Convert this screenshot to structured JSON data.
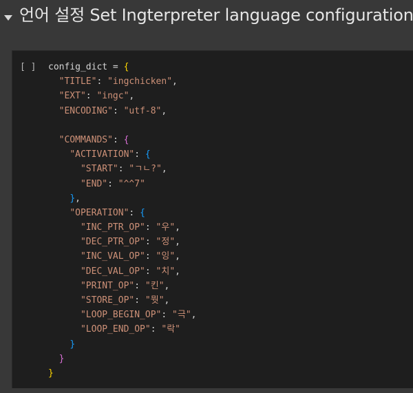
{
  "section": {
    "title": "언어 설정 Set Ingterpreter language configuration",
    "collapse_icon": "caret-down-icon"
  },
  "cell": {
    "run_indicator": "[ ]",
    "code_lines": [
      [
        {
          "t": "config_dict = ",
          "k": "plain"
        },
        {
          "t": "{",
          "k": "brace-0"
        }
      ],
      [
        {
          "t": "  ",
          "k": "plain"
        },
        {
          "t": "\"TITLE\"",
          "k": "string"
        },
        {
          "t": ": ",
          "k": "plain"
        },
        {
          "t": "\"ingchicken\"",
          "k": "string"
        },
        {
          "t": ",",
          "k": "plain"
        }
      ],
      [
        {
          "t": "  ",
          "k": "plain"
        },
        {
          "t": "\"EXT\"",
          "k": "string"
        },
        {
          "t": ": ",
          "k": "plain"
        },
        {
          "t": "\"ingc\"",
          "k": "string"
        },
        {
          "t": ",",
          "k": "plain"
        }
      ],
      [
        {
          "t": "  ",
          "k": "plain"
        },
        {
          "t": "\"ENCODING\"",
          "k": "string"
        },
        {
          "t": ": ",
          "k": "plain"
        },
        {
          "t": "\"utf-8\"",
          "k": "string"
        },
        {
          "t": ",",
          "k": "plain"
        }
      ],
      [
        {
          "t": "",
          "k": "plain"
        }
      ],
      [
        {
          "t": "  ",
          "k": "plain"
        },
        {
          "t": "\"COMMANDS\"",
          "k": "string"
        },
        {
          "t": ": ",
          "k": "plain"
        },
        {
          "t": "{",
          "k": "brace-1"
        }
      ],
      [
        {
          "t": "    ",
          "k": "plain"
        },
        {
          "t": "\"ACTIVATION\"",
          "k": "string"
        },
        {
          "t": ": ",
          "k": "plain"
        },
        {
          "t": "{",
          "k": "brace-2"
        }
      ],
      [
        {
          "t": "      ",
          "k": "plain"
        },
        {
          "t": "\"START\"",
          "k": "string"
        },
        {
          "t": ": ",
          "k": "plain"
        },
        {
          "t": "\"ㄱㄴ?\"",
          "k": "string"
        },
        {
          "t": ",",
          "k": "plain"
        }
      ],
      [
        {
          "t": "      ",
          "k": "plain"
        },
        {
          "t": "\"END\"",
          "k": "string"
        },
        {
          "t": ": ",
          "k": "plain"
        },
        {
          "t": "\"^^7\"",
          "k": "string"
        }
      ],
      [
        {
          "t": "    ",
          "k": "plain"
        },
        {
          "t": "}",
          "k": "brace-2"
        },
        {
          "t": ",",
          "k": "plain"
        }
      ],
      [
        {
          "t": "    ",
          "k": "plain"
        },
        {
          "t": "\"OPERATION\"",
          "k": "string"
        },
        {
          "t": ": ",
          "k": "plain"
        },
        {
          "t": "{",
          "k": "brace-2"
        }
      ],
      [
        {
          "t": "      ",
          "k": "plain"
        },
        {
          "t": "\"INC_PTR_OP\"",
          "k": "string"
        },
        {
          "t": ": ",
          "k": "plain"
        },
        {
          "t": "\"우\"",
          "k": "string"
        },
        {
          "t": ",",
          "k": "plain"
        }
      ],
      [
        {
          "t": "      ",
          "k": "plain"
        },
        {
          "t": "\"DEC_PTR_OP\"",
          "k": "string"
        },
        {
          "t": ": ",
          "k": "plain"
        },
        {
          "t": "\"정\"",
          "k": "string"
        },
        {
          "t": ",",
          "k": "plain"
        }
      ],
      [
        {
          "t": "      ",
          "k": "plain"
        },
        {
          "t": "\"INC_VAL_OP\"",
          "k": "string"
        },
        {
          "t": ": ",
          "k": "plain"
        },
        {
          "t": "\"잉\"",
          "k": "string"
        },
        {
          "t": ",",
          "k": "plain"
        }
      ],
      [
        {
          "t": "      ",
          "k": "plain"
        },
        {
          "t": "\"DEC_VAL_OP\"",
          "k": "string"
        },
        {
          "t": ": ",
          "k": "plain"
        },
        {
          "t": "\"치\"",
          "k": "string"
        },
        {
          "t": ",",
          "k": "plain"
        }
      ],
      [
        {
          "t": "      ",
          "k": "plain"
        },
        {
          "t": "\"PRINT_OP\"",
          "k": "string"
        },
        {
          "t": ": ",
          "k": "plain"
        },
        {
          "t": "\"킨\"",
          "k": "string"
        },
        {
          "t": ",",
          "k": "plain"
        }
      ],
      [
        {
          "t": "      ",
          "k": "plain"
        },
        {
          "t": "\"STORE_OP\"",
          "k": "string"
        },
        {
          "t": ": ",
          "k": "plain"
        },
        {
          "t": "\"뭣\"",
          "k": "string"
        },
        {
          "t": ",",
          "k": "plain"
        }
      ],
      [
        {
          "t": "      ",
          "k": "plain"
        },
        {
          "t": "\"LOOP_BEGIN_OP\"",
          "k": "string"
        },
        {
          "t": ": ",
          "k": "plain"
        },
        {
          "t": "\"극\"",
          "k": "string"
        },
        {
          "t": ",",
          "k": "plain"
        }
      ],
      [
        {
          "t": "      ",
          "k": "plain"
        },
        {
          "t": "\"LOOP_END_OP\"",
          "k": "string"
        },
        {
          "t": ": ",
          "k": "plain"
        },
        {
          "t": "\"락\"",
          "k": "string"
        }
      ],
      [
        {
          "t": "    ",
          "k": "plain"
        },
        {
          "t": "}",
          "k": "brace-2"
        }
      ],
      [
        {
          "t": "  ",
          "k": "plain"
        },
        {
          "t": "}",
          "k": "brace-1"
        }
      ],
      [
        {
          "t": "}",
          "k": "brace-0"
        }
      ]
    ]
  },
  "colors": {
    "page_background": "#383838",
    "cell_background": "#1e1e1e",
    "title_text": "#e6e6e6",
    "string": "#ce9178",
    "plain": "#d4d4d4",
    "brace_level_0": "#ffd700",
    "brace_level_1": "#da70d6",
    "brace_level_2": "#179fff"
  }
}
